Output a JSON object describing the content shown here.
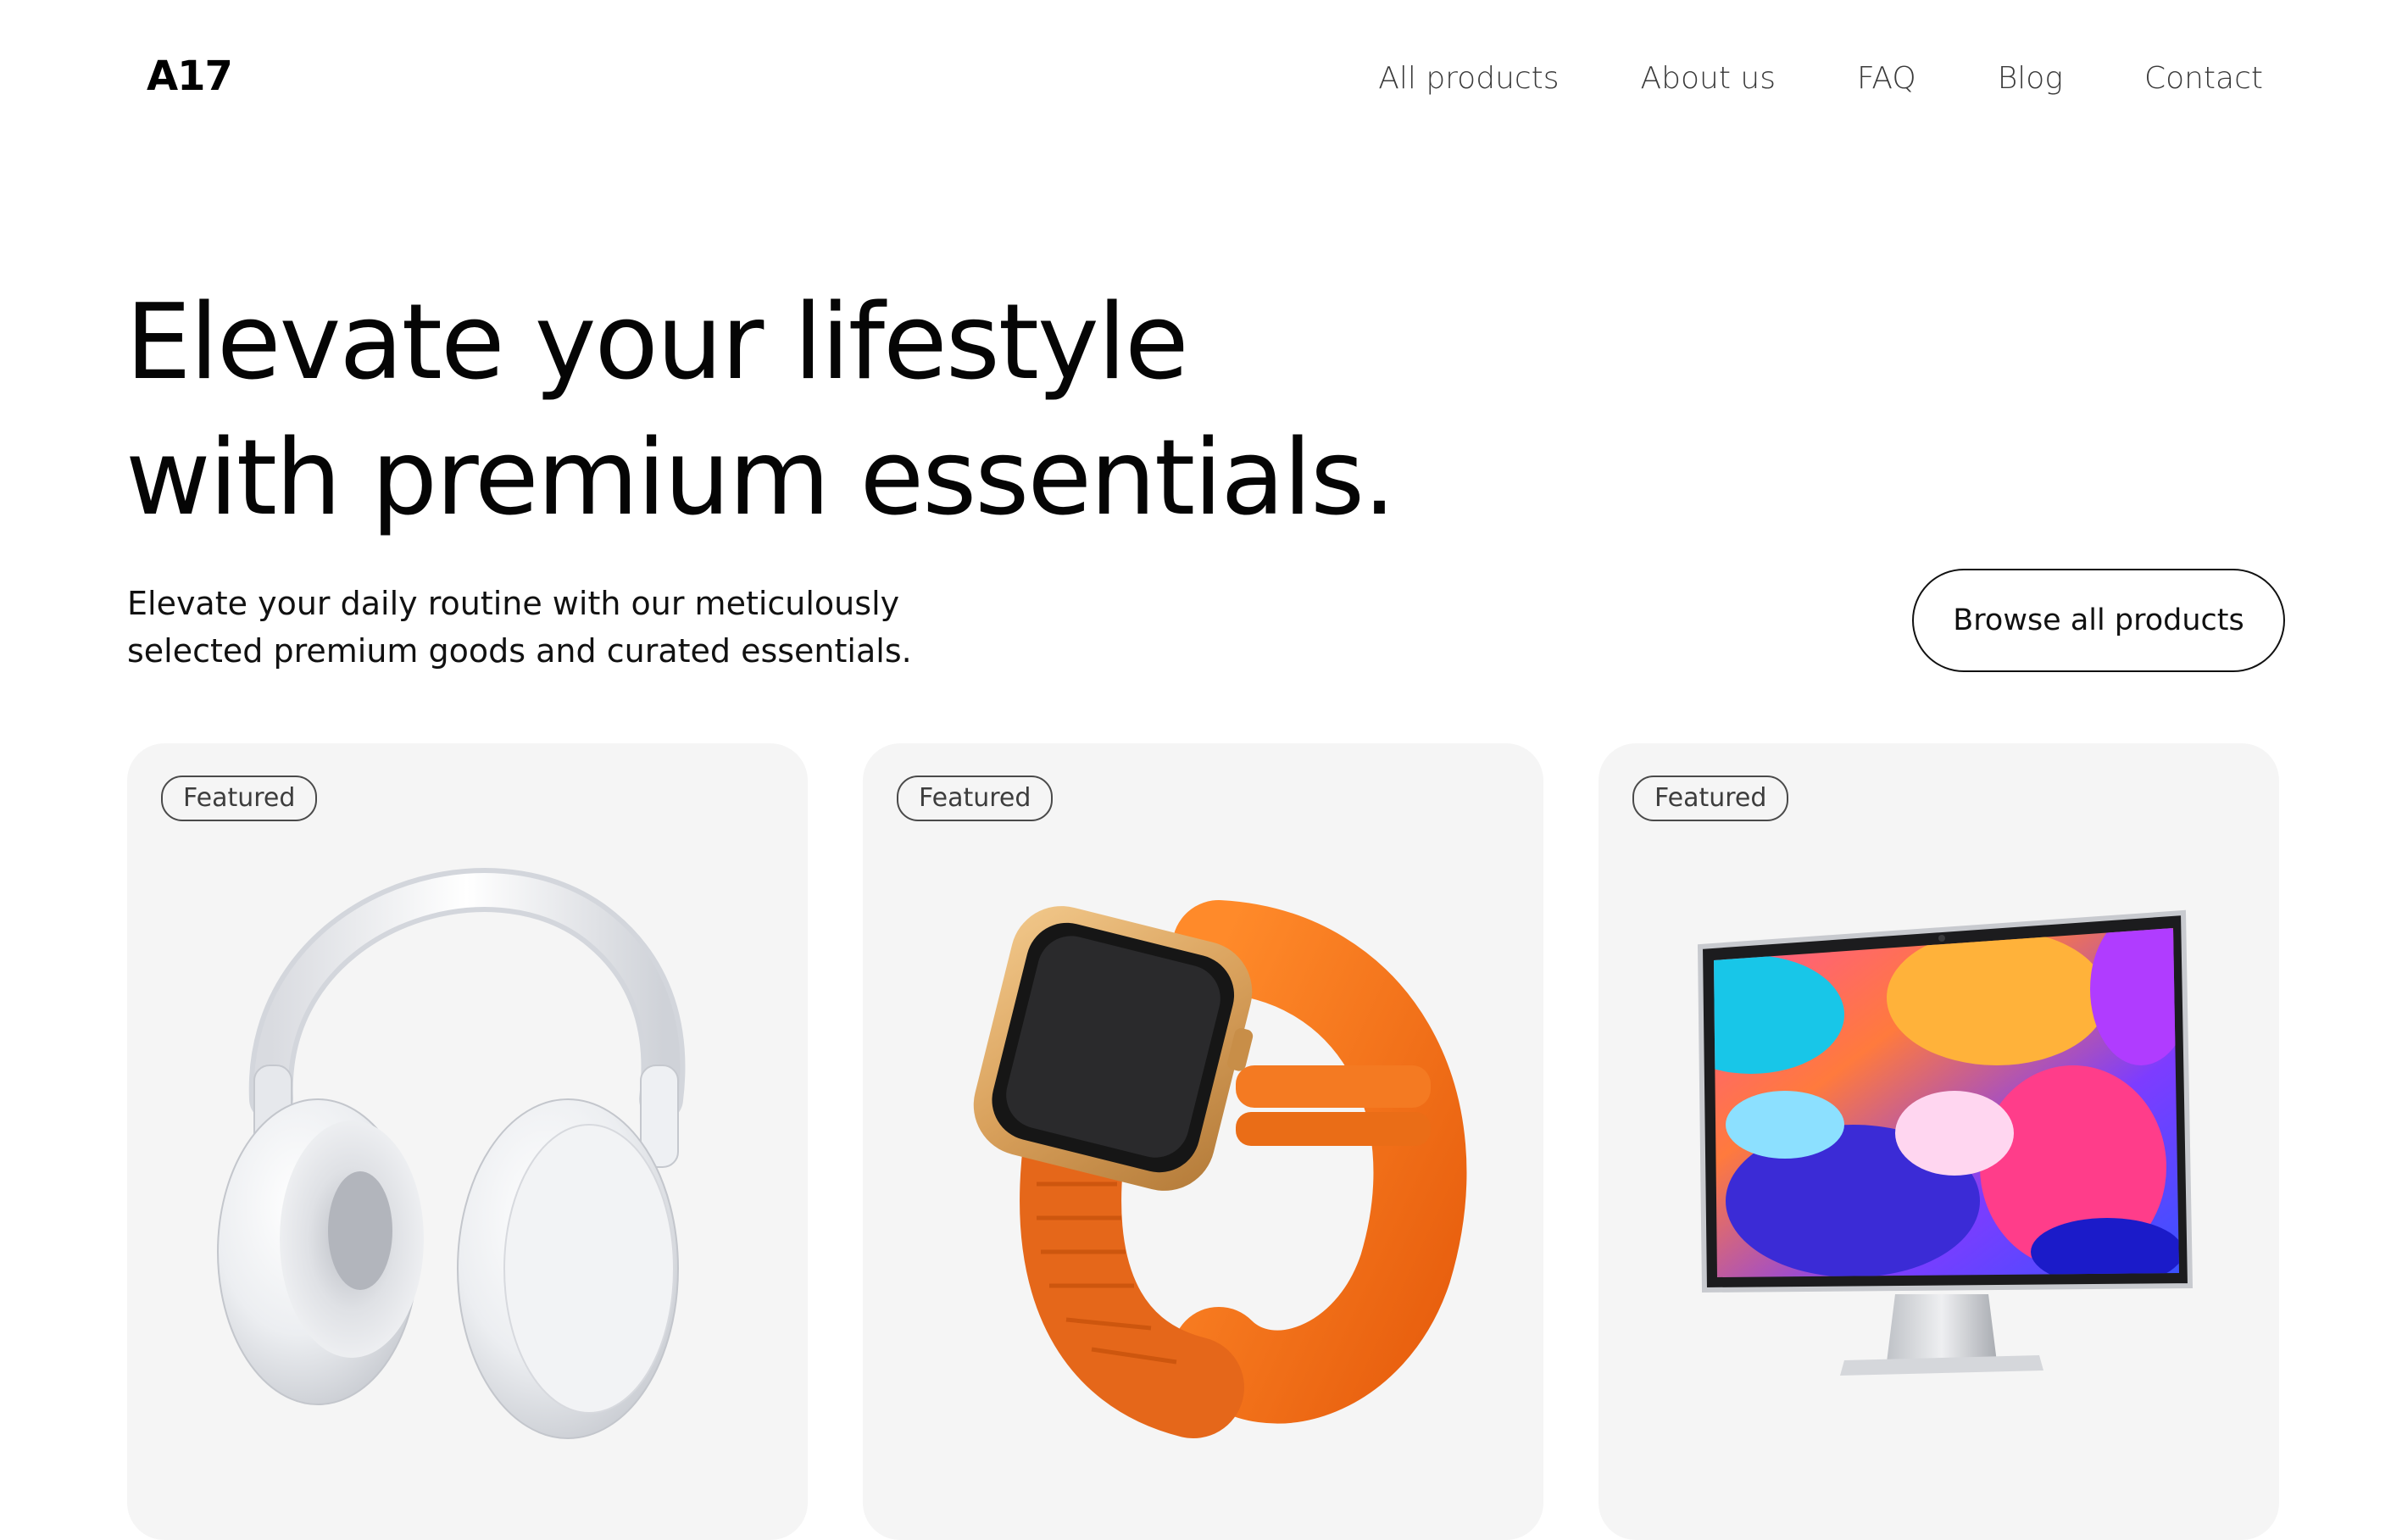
{
  "header": {
    "logo": "A17",
    "nav": [
      "All products",
      "About us",
      "FAQ",
      "Blog",
      "Contact"
    ]
  },
  "hero": {
    "title_lines": [
      "Elevate your lifestyle",
      "with premium essentials."
    ],
    "subtitle_lines": [
      "Elevate your daily routine with our meticulously",
      "selected premium goods and curated essentials."
    ],
    "cta": "Browse all products"
  },
  "products": [
    {
      "badge": "Featured",
      "image": "headphones-image"
    },
    {
      "badge": "Featured",
      "image": "smartwatch-image"
    },
    {
      "badge": "Featured",
      "image": "monitor-image"
    }
  ],
  "colors": {
    "background": "#ffffff",
    "card": "#f5f5f5",
    "text": "#0a0a0a",
    "watch_band": "#ff7a1f",
    "watch_case": "#d9a15c"
  }
}
